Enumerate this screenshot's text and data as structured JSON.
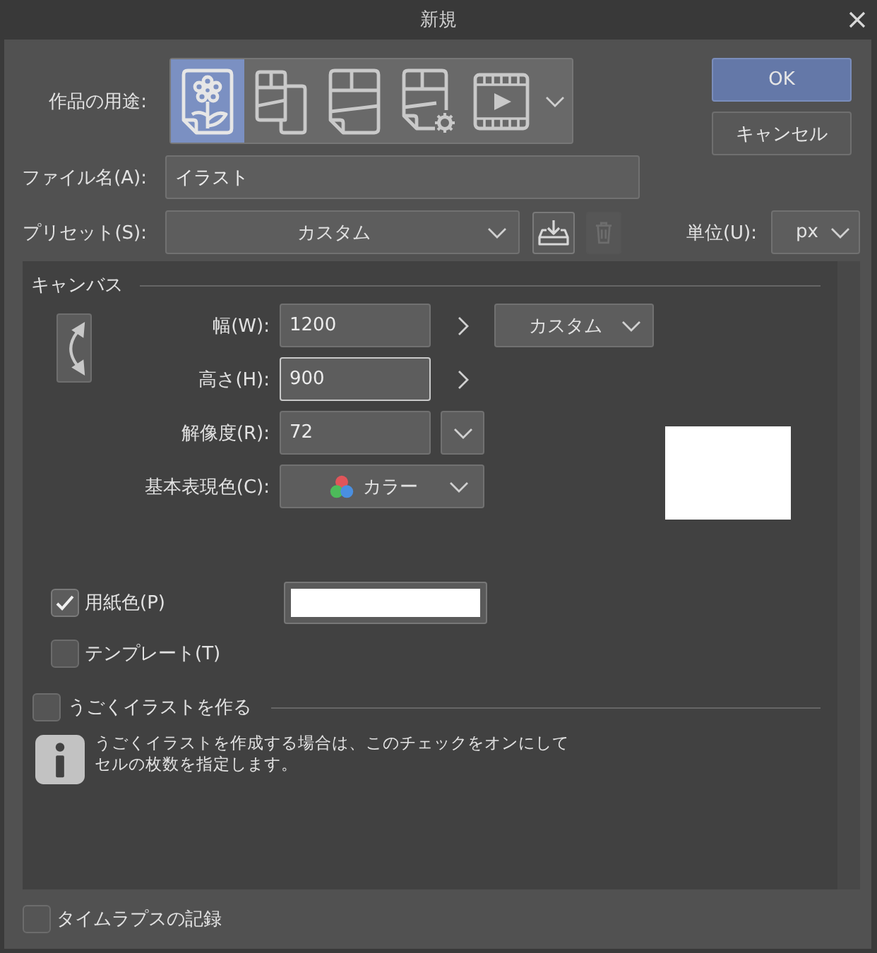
{
  "window": {
    "title": "新規"
  },
  "purpose": {
    "label": "作品の用途:",
    "options": [
      {
        "kind": "flower",
        "selected": true
      },
      {
        "kind": "pages",
        "selected": false
      },
      {
        "kind": "panels",
        "selected": false
      },
      {
        "kind": "gear",
        "selected": false
      },
      {
        "kind": "film",
        "selected": false
      }
    ]
  },
  "buttons": [
    {
      "label": "OK",
      "kind": "primary"
    },
    {
      "label": "キャンセル",
      "kind": "secondary"
    }
  ],
  "file_name": {
    "label": "ファイル名(A):",
    "value": "イラスト"
  },
  "preset": {
    "label": "プリセット(S):",
    "value": "カスタム",
    "actions": [
      {
        "kind": "save",
        "disabled": false
      },
      {
        "kind": "delete",
        "disabled": true
      }
    ]
  },
  "unit": {
    "label": "単位(U):",
    "value": "px"
  },
  "canvas": {
    "title": "キャンバス",
    "width": {
      "label": "幅(W):",
      "value": "1200",
      "focused": false,
      "preset": "カスタム"
    },
    "height": {
      "label": "高さ(H):",
      "value": "900",
      "focused": true
    },
    "resolution": {
      "label": "解像度(R):",
      "value": "72",
      "focused": false
    },
    "color_mode": {
      "label": "基本表現色(C):",
      "value": "カラー"
    },
    "paper_color": {
      "label": "用紙色(P)",
      "checked": true,
      "color": "#ffffff"
    },
    "template": {
      "label": "テンプレート(T)",
      "checked": false
    }
  },
  "animation": {
    "label": "うごくイラストを作る",
    "checked": false,
    "note": "うごくイラストを作成する場合は、このチェックをオンにしてセルの枚数を指定します。"
  },
  "timelapse": {
    "label": "タイムラプスの記録",
    "checked": false
  }
}
